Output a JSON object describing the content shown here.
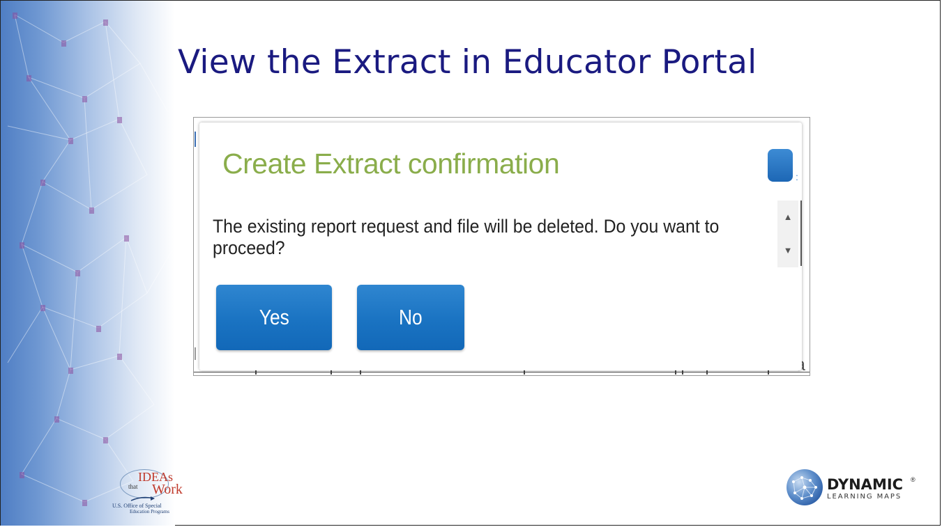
{
  "slide": {
    "title": "View the Extract in Educator Portal"
  },
  "dialog": {
    "title": "Create Extract confirmation",
    "message": "The existing report request and file will be deleted. Do you want to proceed?",
    "buttons": {
      "yes_label": "Yes",
      "no_label": "No"
    },
    "close_icon": "close-icon"
  },
  "background_fragment": "a",
  "colors": {
    "title": "#1a1a80",
    "dialog_title": "#8aad4b",
    "button": "#1a73c2"
  },
  "logos": {
    "ideas": {
      "word1": "IDEAs",
      "word_that": "that",
      "word2": "Work",
      "subtitle_line1": "U.S. Office of Special",
      "subtitle_line2": "Education Programs"
    },
    "dlm": {
      "name": "DYNAMIC",
      "registered": "®",
      "subtitle": "LEARNING MAPS"
    }
  }
}
